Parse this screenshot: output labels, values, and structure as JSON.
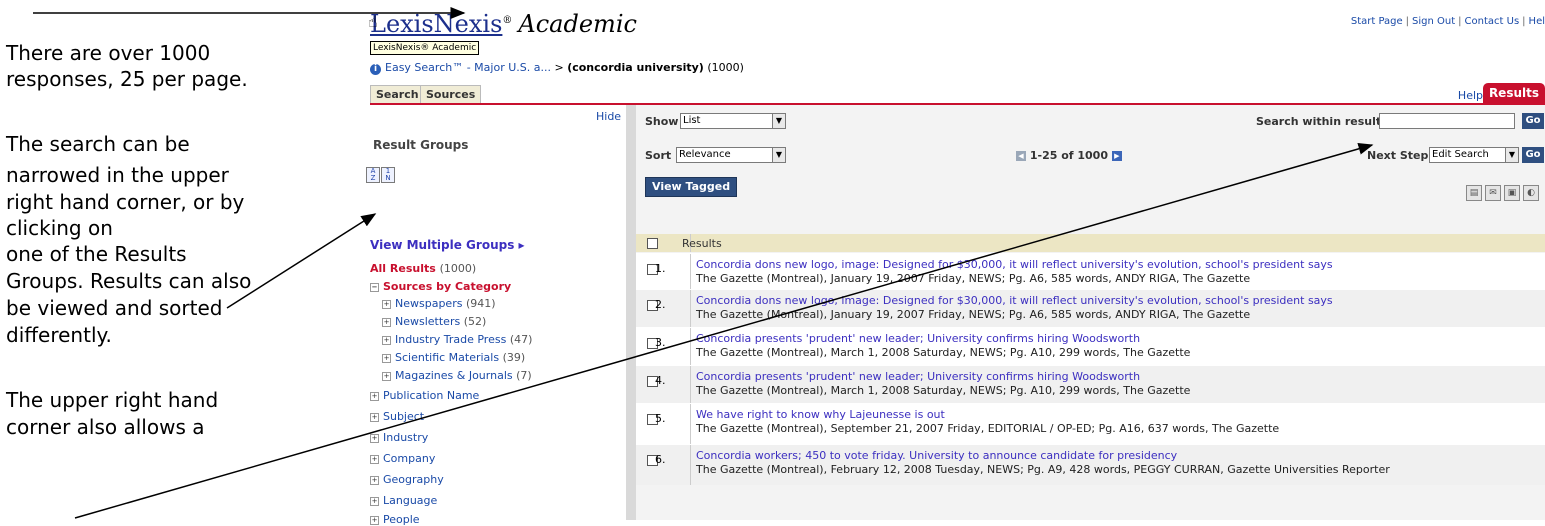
{
  "annotation": {
    "line1": "There are over 1000",
    "line2": "responses, 25 per page.",
    "line3": "The search can be",
    "line4": "narrowed in the upper",
    "line5": "right hand corner, or by",
    "line6": "clicking on",
    "line7": "one of the Results",
    "line8": "Groups. Results can also",
    "line9": "be viewed and sorted",
    "line10": "differently.",
    "line11": "The upper right hand",
    "line12": "corner also allows a"
  },
  "header": {
    "logo_main": "LexisNexis",
    "logo_reg": "®",
    "logo_sub": "Academic",
    "tooltip": "LexisNexis® Academic",
    "links": [
      "Start Page",
      "Sign Out",
      "Contact Us",
      "Hel"
    ]
  },
  "breadcrumb": {
    "info_icon": "i",
    "link": "Easy Search™ - Major U.S. a...",
    "sep": ">",
    "current": "(concordia university)",
    "count": "(1000)"
  },
  "tabs": {
    "search": "Search",
    "sources": "Sources",
    "help": "Help",
    "results": "Results"
  },
  "left_panel": {
    "hide": "Hide",
    "title": "Result Groups",
    "view_multiple": "View Multiple Groups ▸",
    "all_results": "All Results",
    "all_results_count": "(1000)",
    "sources_by_category": "Sources by Category",
    "categories": [
      {
        "label": "Newspapers",
        "count": "(941)"
      },
      {
        "label": "Newsletters",
        "count": "(52)"
      },
      {
        "label": "Industry Trade Press",
        "count": "(47)"
      },
      {
        "label": "Scientific Materials",
        "count": "(39)"
      },
      {
        "label": "Magazines & Journals",
        "count": "(7)"
      }
    ],
    "groups": [
      "Publication Name",
      "Subject",
      "Industry",
      "Company",
      "Geography",
      "Language",
      "People"
    ]
  },
  "toolbar": {
    "show_label": "Show",
    "show_value": "List",
    "sort_label": "Sort",
    "sort_value": "Relevance",
    "pager": "1-25 of 1000",
    "search_within_label": "Search within results",
    "next_steps_label": "Next Steps",
    "next_steps_value": "Edit Search",
    "go": "Go",
    "view_tagged": "View Tagged"
  },
  "results_header": "Results",
  "results": [
    {
      "num": "1.",
      "title": "Concordia dons new logo, image: Designed for $30,000, it will reflect university's evolution, school's president says",
      "meta": "The Gazette (Montreal), January 19, 2007 Friday, NEWS; Pg. A6, 585 words, ANDY RIGA, The Gazette"
    },
    {
      "num": "2.",
      "title": "Concordia dons new logo, image: Designed for $30,000, it will reflect university's evolution, school's president says",
      "meta": "The Gazette (Montreal), January 19, 2007 Friday, NEWS; Pg. A6, 585 words, ANDY RIGA, The Gazette"
    },
    {
      "num": "3.",
      "title": "Concordia presents 'prudent' new leader; University confirms hiring Woodsworth",
      "meta": "The Gazette (Montreal), March 1, 2008 Saturday, NEWS; Pg. A10, 299 words, The Gazette"
    },
    {
      "num": "4.",
      "title": "Concordia presents 'prudent' new leader; University confirms hiring Woodsworth",
      "meta": "The Gazette (Montreal), March 1, 2008 Saturday, NEWS; Pg. A10, 299 words, The Gazette"
    },
    {
      "num": "5.",
      "title": "We have right to know why Lajeunesse is out",
      "meta": "The Gazette (Montreal), September 21, 2007 Friday, EDITORIAL / OP-ED; Pg. A16, 637 words, The Gazette"
    },
    {
      "num": "6.",
      "title": "Concordia workers; 450 to vote friday. University to announce candidate for presidency",
      "meta": "The Gazette (Montreal), February 12, 2008 Tuesday, NEWS; Pg. A9, 428 words, PEGGY CURRAN, Gazette Universities Reporter"
    }
  ],
  "colors": {
    "accent": "#c8102e",
    "link": "#1a4aa7",
    "button": "#2f4f80"
  }
}
